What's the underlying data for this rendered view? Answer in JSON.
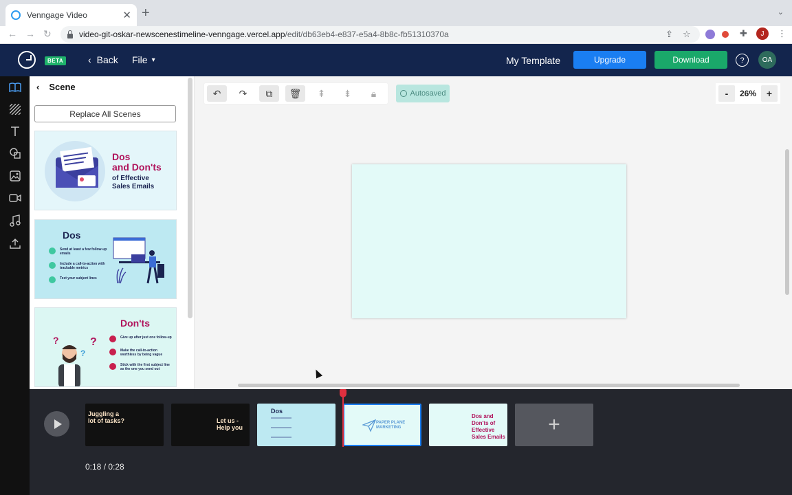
{
  "browser": {
    "tab_title": "Venngage Video",
    "new_tab": "+",
    "url_host": "video-git-oskar-newscenestimeline-venngage.vercel.app",
    "url_path": "/edit/db63eb4-e837-e5a4-8b8c-fb51310370a",
    "profile_initial": "J"
  },
  "header": {
    "beta": "BETA",
    "back_label": "Back",
    "file_label": "File",
    "template_name": "My Template",
    "upgrade_label": "Upgrade",
    "download_label": "Download",
    "help_label": "?",
    "avatar_initials": "OA"
  },
  "panel": {
    "title": "Scene",
    "replace_label": "Replace All Scenes",
    "scenes": [
      {
        "title": "Dos",
        "title2": "and Don'ts",
        "sub1": "of Effective",
        "sub2": "Sales Emails"
      },
      {
        "title": "Dos",
        "items": [
          "Send at least a few follow-up emails",
          "Include a call-to-action with trackable metrics",
          "Test your subject lines"
        ]
      },
      {
        "title": "Don'ts",
        "items": [
          "Give up after just one follow-up",
          "Make the call-to-action worthless by being vague",
          "Stick with the first subject line as the one you send out"
        ]
      }
    ]
  },
  "toolbar": {
    "autosaved": "Autosaved",
    "zoom_value": "26%",
    "zoom_minus": "-",
    "zoom_plus": "+"
  },
  "timeline": {
    "current_time": "0:18",
    "separator": " / ",
    "total_time": "0:28",
    "clips": [
      {
        "text": "Juggling a lot of tasks?"
      },
      {
        "text": "Let us - Help you"
      },
      {
        "text": "Dos"
      },
      {
        "text": "PAPER PLANE MARKETING"
      },
      {
        "text": "Dos and Don'ts of Effective Sales Emails"
      }
    ]
  },
  "colors": {
    "header_bg": "#13254d",
    "upgrade": "#1a7ef2",
    "download": "#1aa86a",
    "stage_bg": "#e3faf8",
    "accent_pink": "#b0135b",
    "playhead": "#e0303f"
  }
}
